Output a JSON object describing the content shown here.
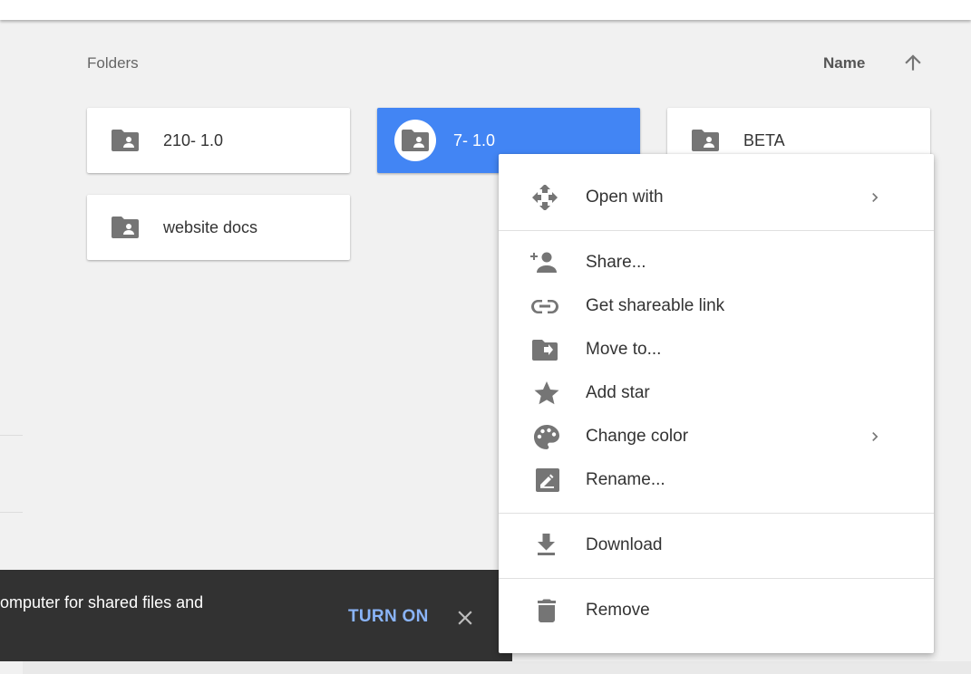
{
  "header": {
    "folders_label": "Folders",
    "sort_label": "Name",
    "sort_icon": "arrow-up-icon"
  },
  "folders": [
    {
      "name": "210- 1.0",
      "icon": "shared-folder-icon",
      "selected": false
    },
    {
      "name": "7- 1.0",
      "icon": "shared-folder-icon",
      "selected": true
    },
    {
      "name": "BETA",
      "icon": "shared-folder-icon",
      "selected": false
    },
    {
      "name": "website docs",
      "icon": "shared-folder-icon",
      "selected": false
    }
  ],
  "context_menu": {
    "items": [
      {
        "label": "Open with",
        "icon": "open-with-icon",
        "submenu": true
      },
      {
        "label": "Share...",
        "icon": "add-person-icon",
        "submenu": false
      },
      {
        "label": "Get shareable link",
        "icon": "link-icon",
        "submenu": false
      },
      {
        "label": "Move to...",
        "icon": "move-to-folder-icon",
        "submenu": false
      },
      {
        "label": "Add star",
        "icon": "star-icon",
        "submenu": false
      },
      {
        "label": "Change color",
        "icon": "palette-icon",
        "submenu": true
      },
      {
        "label": "Rename...",
        "icon": "rename-icon",
        "submenu": false
      },
      {
        "label": "Download",
        "icon": "download-icon",
        "submenu": false
      },
      {
        "label": "Remove",
        "icon": "trash-icon",
        "submenu": false
      }
    ]
  },
  "snackbar": {
    "text": "omputer for shared files and",
    "action_label": "TURN ON",
    "close_icon": "close-icon"
  },
  "colors": {
    "background": "#f1f1f1",
    "selected_folder": "#4285f4",
    "icon_gray": "#757575",
    "snackbar_bg": "#323232",
    "snackbar_action": "#8ab4f8"
  }
}
